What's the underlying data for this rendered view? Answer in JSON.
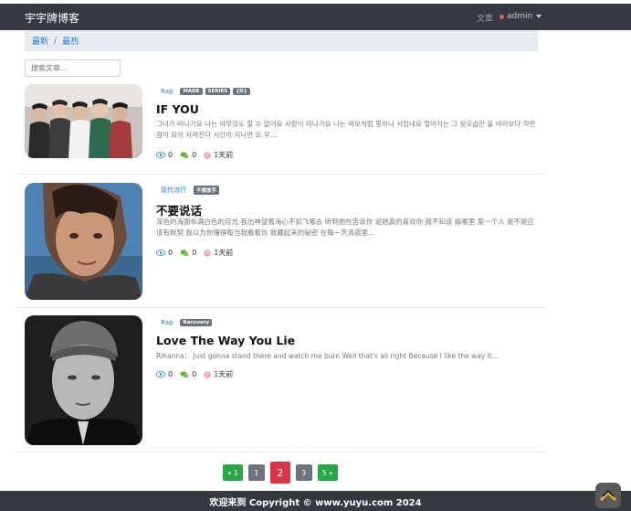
{
  "header": {
    "brand": "宇宇牌博客",
    "nav_articles": "文章",
    "user": "admin"
  },
  "breadcrumb": {
    "items": [
      "最新",
      "最热"
    ],
    "separator": "/"
  },
  "search": {
    "placeholder": "搜索文章..."
  },
  "posts": [
    {
      "category": "Rap",
      "tags": [
        "MADE",
        "SERIES",
        "{D}"
      ],
      "title": "IF YOU",
      "excerpt": "그녀가 떠나가요 나는 아무것도 할 수 없어요 사랑이 떠나가요 나는 바보처럼 멍하니 서있네요 멀어지는 그 뒷모습만 을 바라보다 작은 점이 되어 사라진다 시간이 지나면 또 무...",
      "views": "0",
      "comments": "0",
      "time": "1天前"
    },
    {
      "category": "现代流行",
      "tags": [
        "不想放手"
      ],
      "title": "不要说话",
      "excerpt": "深色的海面布满白色的月光 我出神望着海心不知飞哪去 听到她在告诉你 说她真的喜欢你 我不知该 躲哪里 爱一个人 是不是应该有默契 我以为你懂得每当我看着你 我藏起来的秘密 在每一天清晨里...",
      "views": "0",
      "comments": "0",
      "time": "1天前"
    },
    {
      "category": "Rap",
      "tags": [
        "Recovery"
      ],
      "title": "Love The Way You Lie",
      "excerpt": "Rihanna： Just gonna stand there and watch me burn Well that's all right Because I like the way it...",
      "views": "0",
      "comments": "0",
      "time": "1天前"
    }
  ],
  "pagination": {
    "prev": "« 1",
    "pages": [
      "1",
      "2",
      "3"
    ],
    "next": "5 »",
    "current": "2"
  },
  "footer": {
    "text": "欢迎来到 Copyright © www.yuyu.com 2024"
  },
  "colors": {
    "navbar": "#343a40",
    "link": "#1f7ae0",
    "tag": "#6c757d",
    "page_green": "#28a745",
    "page_active": "#dc3545"
  }
}
